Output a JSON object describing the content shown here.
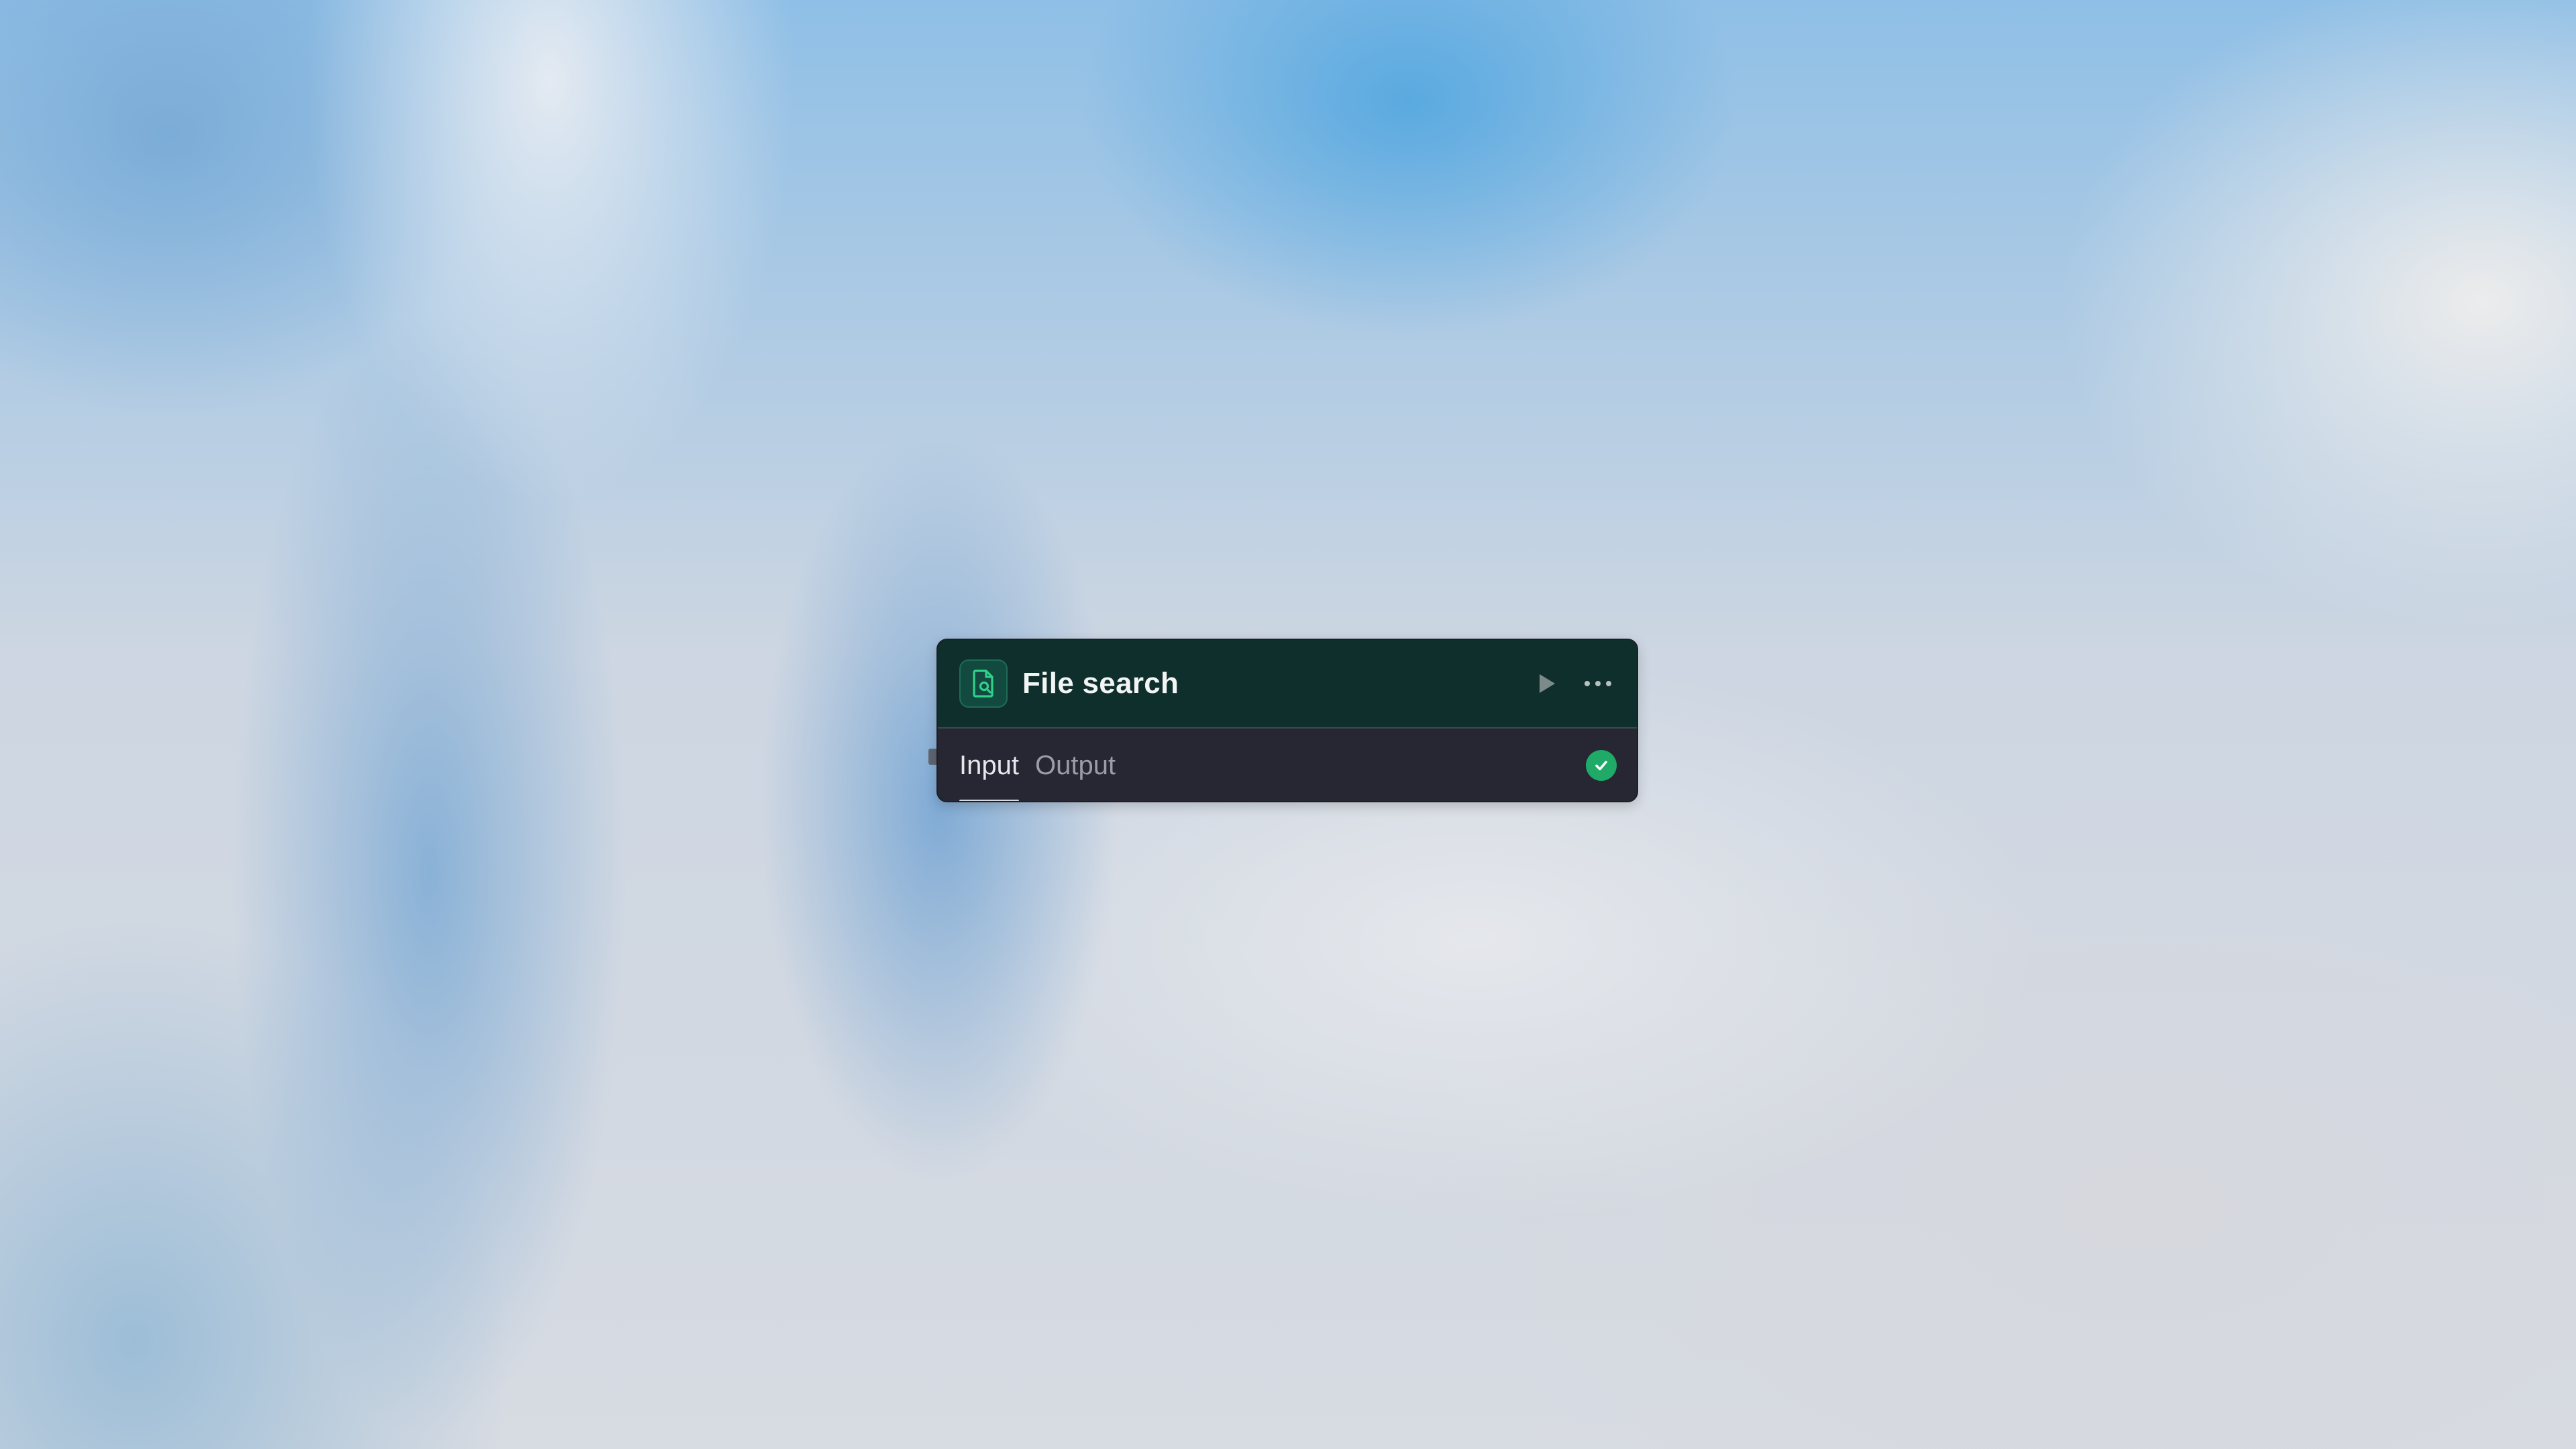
{
  "node": {
    "title": "File search",
    "icon": "file-search-icon",
    "accent_color": "#1faa67",
    "header_bg": "#0f2f2d",
    "body_bg": "#262732",
    "actions": [
      {
        "name": "run",
        "icon": "play-icon"
      },
      {
        "name": "more",
        "icon": "more-horizontal-icon"
      }
    ],
    "tabs": [
      {
        "label": "Input",
        "active": true
      },
      {
        "label": "Output",
        "active": false
      }
    ],
    "status": {
      "icon": "check-circle-icon",
      "state": "success"
    }
  }
}
